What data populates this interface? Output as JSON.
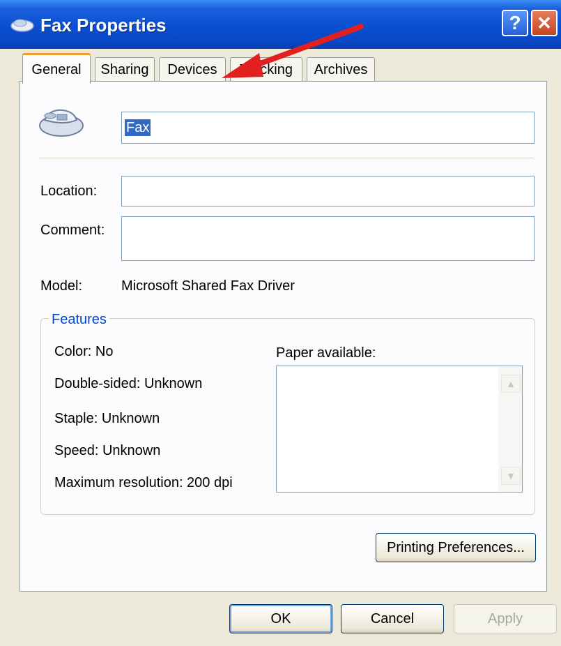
{
  "window": {
    "title": "Fax Properties"
  },
  "titlebar": {
    "help_label": "?",
    "close_label": "✕"
  },
  "tabs": [
    {
      "label": "General",
      "active": true
    },
    {
      "label": "Sharing",
      "active": false
    },
    {
      "label": "Devices",
      "active": false
    },
    {
      "label": "Tracking",
      "active": false
    },
    {
      "label": "Archives",
      "active": false
    }
  ],
  "general": {
    "printer_name": "Fax",
    "location_label": "Location:",
    "location_value": "",
    "comment_label": "Comment:",
    "comment_value": "",
    "model_label": "Model:",
    "model_value": "Microsoft Shared Fax Driver"
  },
  "features": {
    "title": "Features",
    "color": "Color: No",
    "double_sided": "Double-sided: Unknown",
    "staple": "Staple: Unknown",
    "speed": "Speed: Unknown",
    "max_resolution": "Maximum resolution: 200 dpi",
    "paper_label": "Paper available:",
    "paper_items": []
  },
  "buttons": {
    "printing_preferences": "Printing Preferences...",
    "ok": "OK",
    "cancel": "Cancel",
    "apply": "Apply"
  },
  "annotation": {
    "arrow_color": "#e32020"
  }
}
